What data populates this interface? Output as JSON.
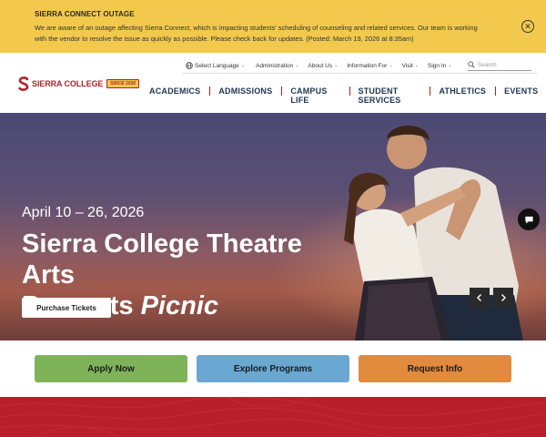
{
  "alert": {
    "title": "SIERRA CONNECT OUTAGE",
    "body": "We are aware of an outage affecting Sierra Connect, which is impacting students' scheduling of counseling and related services. Our team is working with the vendor to resolve the issue as quickly as possible. Please check back for updates. (Posted: March 19, 2026 at 8:35am)",
    "close_icon": "close-icon"
  },
  "utility_nav": {
    "select_language": "Select Language",
    "items": [
      "Administration",
      "About Us",
      "Information For",
      "Visit",
      "Sign In"
    ],
    "search_placeholder": "Search"
  },
  "logo": {
    "name": "SIERRA COLLEGE",
    "badge": "SINCE 1936"
  },
  "main_nav": {
    "items": [
      "ACADEMICS",
      "ADMISSIONS",
      "CAMPUS",
      "LIFE",
      "STUDENT",
      "SERVICES",
      "ATHLETICS",
      "EVENTS"
    ]
  },
  "hero": {
    "date": "April 10 – 26, 2026",
    "title_line1": "Sierra College Theatre Arts",
    "title_line2_plain": "Presents ",
    "title_line2_italic": "Picnic",
    "button": "Purchase Tickets",
    "prev_icon": "chevron-left-icon",
    "next_icon": "chevron-right-icon"
  },
  "actions": {
    "apply": "Apply Now",
    "explore": "Explore Programs",
    "request": "Request Info"
  },
  "colors": {
    "alert_bg": "#f2c94c",
    "brand_red": "#b3202a",
    "nav_text": "#1f3550",
    "apply": "#7fb35a",
    "explore": "#6aa7d1",
    "request": "#e28a3e"
  }
}
